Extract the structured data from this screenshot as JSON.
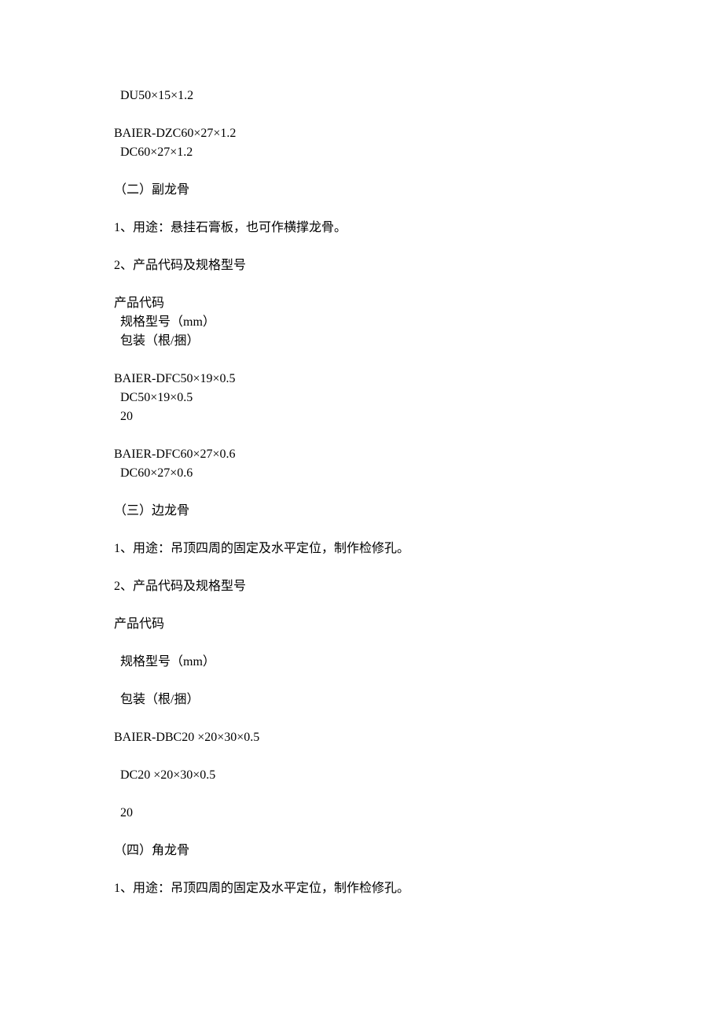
{
  "lines": [
    {
      "text": "  DU50×15×1.2",
      "indent": false
    },
    {
      "text": "",
      "indent": false,
      "spacer": true
    },
    {
      "text": "BAIER-DZC60×27×1.2",
      "indent": false
    },
    {
      "text": "  DC60×27×1.2",
      "indent": false
    },
    {
      "text": "",
      "indent": false,
      "spacer": true
    },
    {
      "text": "（二）副龙骨",
      "indent": false
    },
    {
      "text": "",
      "indent": false,
      "spacer": true
    },
    {
      "text": "1、用途：悬挂石膏板，也可作横撑龙骨。",
      "indent": false
    },
    {
      "text": "",
      "indent": false,
      "spacer": true
    },
    {
      "text": "2、产品代码及规格型号",
      "indent": false
    },
    {
      "text": "",
      "indent": false,
      "spacer": true
    },
    {
      "text": "产品代码",
      "indent": false
    },
    {
      "text": "  规格型号（mm）",
      "indent": false
    },
    {
      "text": "  包装（根/捆）",
      "indent": false
    },
    {
      "text": "",
      "indent": false,
      "spacer": true
    },
    {
      "text": "BAIER-DFC50×19×0.5",
      "indent": false
    },
    {
      "text": "  DC50×19×0.5",
      "indent": false
    },
    {
      "text": "  20",
      "indent": false
    },
    {
      "text": "",
      "indent": false,
      "spacer": true
    },
    {
      "text": "BAIER-DFC60×27×0.6",
      "indent": false
    },
    {
      "text": "  DC60×27×0.6",
      "indent": false
    },
    {
      "text": "",
      "indent": false,
      "spacer": true
    },
    {
      "text": "（三）边龙骨",
      "indent": false
    },
    {
      "text": "",
      "indent": false,
      "spacer": true
    },
    {
      "text": "1、用途：吊顶四周的固定及水平定位，制作检修孔。",
      "indent": false
    },
    {
      "text": "",
      "indent": false,
      "spacer": true
    },
    {
      "text": "2、产品代码及规格型号",
      "indent": false
    },
    {
      "text": "",
      "indent": false,
      "spacer": true
    },
    {
      "text": "产品代码",
      "indent": false
    },
    {
      "text": "",
      "indent": false,
      "spacer": true
    },
    {
      "text": "  规格型号（mm）",
      "indent": false
    },
    {
      "text": "",
      "indent": false,
      "spacer": true
    },
    {
      "text": "  包装（根/捆）",
      "indent": false
    },
    {
      "text": "",
      "indent": false,
      "spacer": true
    },
    {
      "text": "BAIER-DBC20 ×20×30×0.5",
      "indent": false
    },
    {
      "text": "",
      "indent": false,
      "spacer": true
    },
    {
      "text": "  DC20 ×20×30×0.5",
      "indent": false
    },
    {
      "text": "",
      "indent": false,
      "spacer": true
    },
    {
      "text": "  20",
      "indent": false
    },
    {
      "text": "",
      "indent": false,
      "spacer": true
    },
    {
      "text": "（四）角龙骨",
      "indent": false
    },
    {
      "text": "",
      "indent": false,
      "spacer": true
    },
    {
      "text": "1、用途：吊顶四周的固定及水平定位，制作检修孔。",
      "indent": false
    }
  ]
}
